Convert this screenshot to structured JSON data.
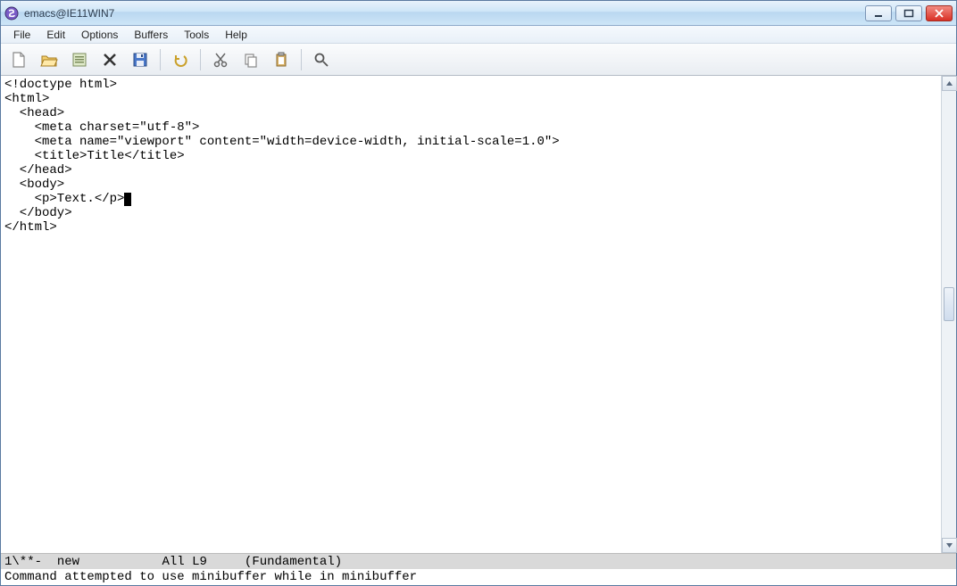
{
  "window": {
    "title": "emacs@IE11WIN7"
  },
  "menu": {
    "items": [
      "File",
      "Edit",
      "Options",
      "Buffers",
      "Tools",
      "Help"
    ]
  },
  "toolbar": {
    "icons": [
      "new-file-icon",
      "open-file-icon",
      "dired-icon",
      "kill-buffer-icon",
      "save-icon",
      "sep",
      "undo-icon",
      "sep",
      "cut-icon",
      "copy-icon",
      "paste-icon",
      "sep",
      "search-icon"
    ]
  },
  "editor": {
    "lines": [
      "<!doctype html>",
      "<html>",
      "  <head>",
      "    <meta charset=\"utf-8\">",
      "    <meta name=\"viewport\" content=\"width=device-width, initial-scale=1.0\">",
      "    <title>Title</title>",
      "  </head>",
      "  <body>",
      "    <p>Text.</p>",
      "  </body>",
      "</html>"
    ],
    "cursor_line_index": 8
  },
  "modeline": {
    "modified": "1\\**-",
    "buffer": "new",
    "position": "All",
    "line": "L9",
    "mode": "(Fundamental)"
  },
  "minibuffer": {
    "message": "Command attempted to use minibuffer while in minibuffer"
  }
}
